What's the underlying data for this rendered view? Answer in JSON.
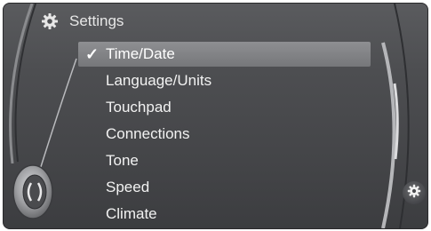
{
  "header": {
    "title": "Settings",
    "icon": "gear-icon"
  },
  "menu": {
    "items": [
      {
        "label": "Time/Date",
        "selected": true
      },
      {
        "label": "Language/Units",
        "selected": false
      },
      {
        "label": "Touchpad",
        "selected": false
      },
      {
        "label": "Connections",
        "selected": false
      },
      {
        "label": "Tone",
        "selected": false
      },
      {
        "label": "Speed",
        "selected": false
      },
      {
        "label": "Climate",
        "selected": false
      }
    ],
    "check_mark": "✓"
  },
  "colors": {
    "background": "#4d4e51",
    "highlight": "#86878a",
    "text": "#f2f2f2"
  }
}
